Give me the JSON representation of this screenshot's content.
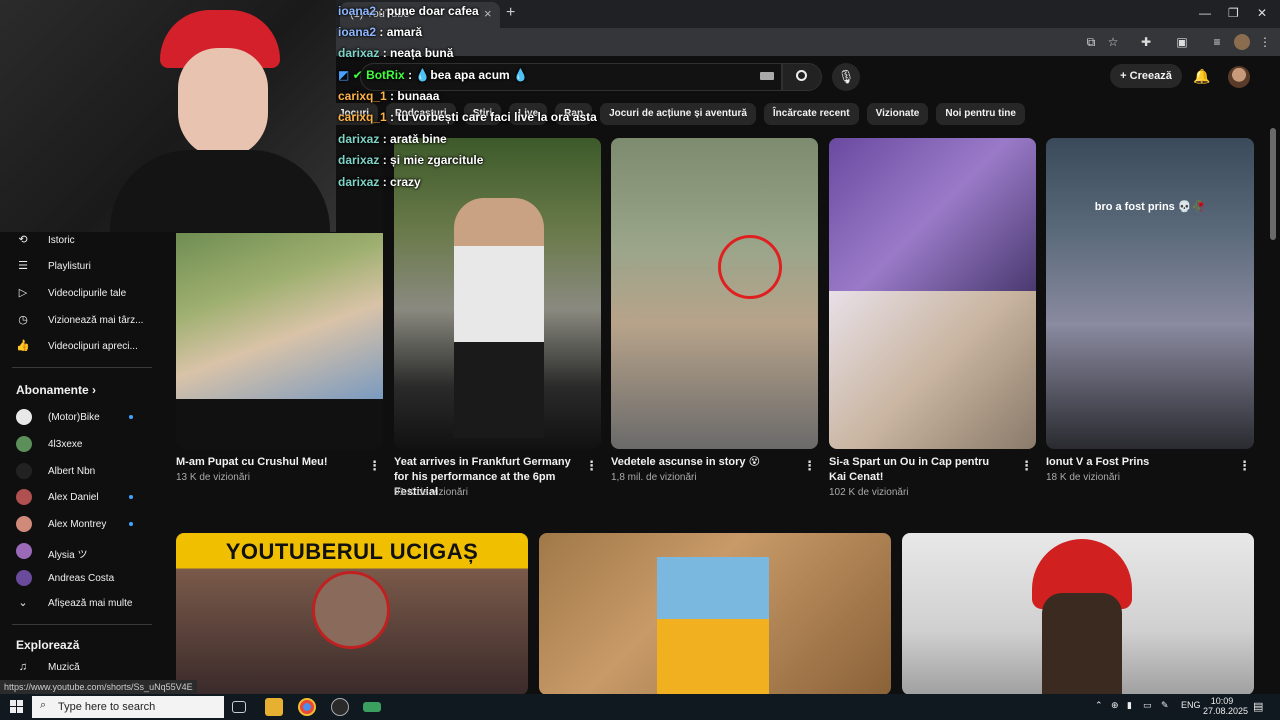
{
  "browser": {
    "tab_title": "(1) YouTube",
    "minimize": "—",
    "restore": "❐",
    "close": "✕",
    "new_tab": "+",
    "tab_close": "×"
  },
  "youtube": {
    "create_label": "Creează",
    "chips": [
      "Jocuri",
      "Podcasturi",
      "Știri",
      "Live",
      "Rap",
      "Jocuri de acțiune și aventură",
      "Încărcate recent",
      "Vizionate",
      "Noi pentru tine"
    ]
  },
  "sidebar": {
    "items": [
      {
        "label": "Istoric",
        "icon": "⟲"
      },
      {
        "label": "Playlisturi",
        "icon": "☰"
      },
      {
        "label": "Videoclipurile tale",
        "icon": "▷"
      },
      {
        "label": "Vizionează mai târz...",
        "icon": "◷"
      },
      {
        "label": "Videoclipuri apreci...",
        "icon": "👍"
      }
    ],
    "subscriptions_heading": "Abonamente",
    "subscriptions_arrow": "›",
    "subscriptions": [
      {
        "label": "(Motor)Bike",
        "color": "#e8e8e8",
        "dot": true
      },
      {
        "label": "4l3xexe",
        "color": "#5c8f5a",
        "dot": false
      },
      {
        "label": "Albert Nbn",
        "color": "#222222",
        "dot": false
      },
      {
        "label": "Alex Daniel",
        "color": "#b05050",
        "dot": true
      },
      {
        "label": "Alex Montrey",
        "color": "#d08a7a",
        "dot": true
      },
      {
        "label": "Alysia ツ",
        "color": "#9a6ab8",
        "dot": false
      },
      {
        "label": "Andreas Costa",
        "color": "#6a4a9a",
        "dot": false
      }
    ],
    "show_more": "Afișează mai multe",
    "explore_heading": "Explorează",
    "music": "Muzică"
  },
  "videos": [
    {
      "title": "M-am Pupat cu Crushul Meu!",
      "meta": "13 K de vizionări"
    },
    {
      "title": "Yeat arrives in Frankfurt Germany for his performance at the 6pm Festivial",
      "meta": "91 K de vizionări"
    },
    {
      "title": "Vedetele ascunse in story 😵",
      "meta": "1,8 mil. de vizionări"
    },
    {
      "title": "Si-a Spart un Ou in Cap pentru Kai Cenat!",
      "meta": "102 K de vizionări"
    },
    {
      "title": "Ionut V a Fost Prins",
      "meta": "18 K de vizionări",
      "thumb_caption": "bro a fost prins 💀🥀"
    }
  ],
  "big_thumbs": [
    {
      "caption": "YOUTUBERUL UCIGAȘ"
    },
    {
      "caption": ""
    },
    {
      "caption": ""
    }
  ],
  "chat": [
    {
      "user": "ioana2",
      "text": "pune doar cafea",
      "color": "#8fb7ff"
    },
    {
      "user": "ioana2",
      "text": "amară",
      "color": "#8fb7ff"
    },
    {
      "user": "darixaz",
      "text": "neața bună",
      "color": "#7fd4c8"
    },
    {
      "user": "BotRix",
      "text": "bea apa acum",
      "color": "#41ff3f"
    },
    {
      "user": "carixq_1",
      "text": "bunaaa",
      "color": "#ffb347"
    },
    {
      "user": "carixq_1",
      "text": "tu vorbești care faci live la ora asta",
      "color": "#ffb347"
    },
    {
      "user": "darixaz",
      "text": "arată bine",
      "color": "#7fd4c8"
    },
    {
      "user": "darixaz",
      "text": "și mie zgarcitule",
      "color": "#7fd4c8"
    },
    {
      "user": "darixaz",
      "text": "crazy",
      "color": "#7fd4c8"
    }
  ],
  "status_url": "https://www.youtube.com/shorts/Ss_uNq55V4E",
  "taskbar": {
    "search_placeholder": "Type here to search",
    "language": "ENG",
    "time": "10:09",
    "date": "27.08.2025"
  }
}
